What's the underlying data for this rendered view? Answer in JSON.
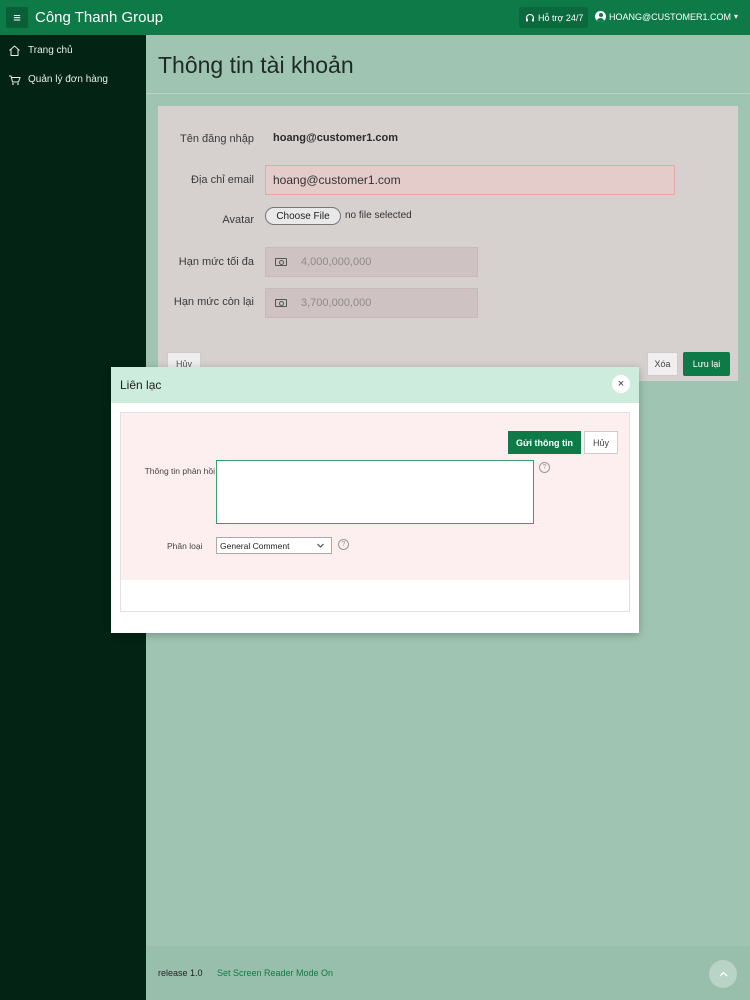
{
  "topbar": {
    "menu_glyph": "≡",
    "app_title": "Công Thanh Group",
    "support_label": "Hỗ trợ 24/7",
    "user_label": "HOANG@CUSTOMER1.COM",
    "user_caret": "▾"
  },
  "sidebar": {
    "items": [
      {
        "label": "Trang chủ",
        "icon": "home-icon"
      },
      {
        "label": "Quản lý đơn hàng",
        "icon": "cart-icon"
      }
    ]
  },
  "page": {
    "title": "Thông tin tài khoản"
  },
  "account_form": {
    "username_label": "Tên đăng nhập",
    "username_value": "hoang@customer1.com",
    "email_label": "Địa chỉ email",
    "email_value": "hoang@customer1.com",
    "avatar_label": "Avatar",
    "choose_file_label": "Choose File",
    "file_status": "no file selected",
    "max_limit_label": "Hạn mức tối đa",
    "max_limit_value": "4,000,000,000",
    "remaining_limit_label": "Hạn mức còn lại",
    "remaining_limit_value": "3,700,000,000",
    "cancel_label": "Hủy",
    "delete_label": "Xóa",
    "save_label": "Lưu lại"
  },
  "contact_modal": {
    "title": "Liên lạc",
    "close_glyph": "×",
    "send_label": "Gửi thông tin",
    "cancel_label": "Hủy",
    "feedback_label": "Thông tin phản hồi",
    "feedback_value": "",
    "category_label": "Phân loại",
    "category_selected": "General Comment",
    "help_glyph": "?"
  },
  "footer": {
    "release": "release 1.0",
    "screen_reader_link": "Set Screen Reader Mode On",
    "scroll_top_glyph": "^"
  },
  "colors": {
    "primary": "#0e7a47",
    "sidebar_bg": "#032414",
    "main_bg": "#9fc5b2",
    "modal_header_bg": "#cdecde"
  }
}
